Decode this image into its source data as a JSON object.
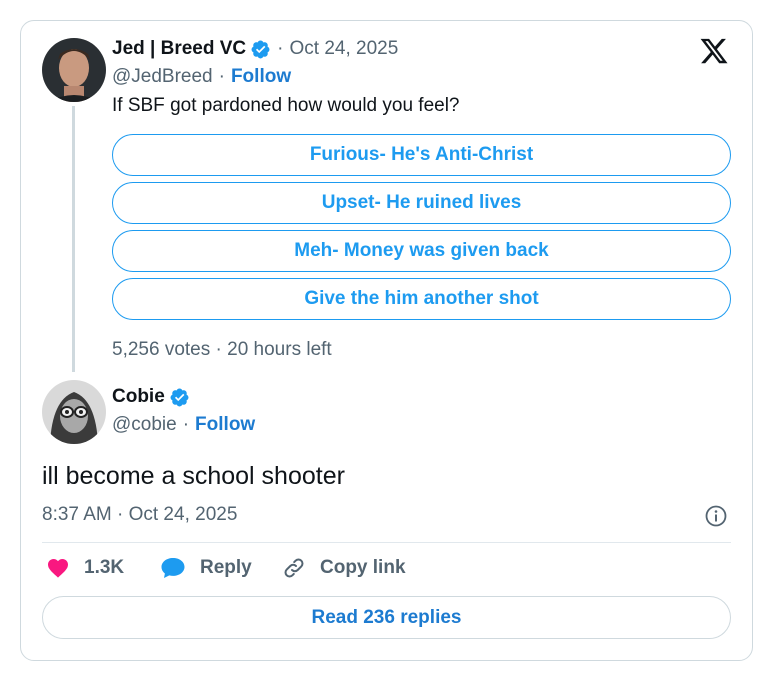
{
  "parent": {
    "author_name": "Jed | Breed VC",
    "handle": "@JedBreed",
    "date": "Oct 24, 2025",
    "follow_label": "Follow",
    "question": "If SBF got pardoned how would you feel?",
    "poll_options": [
      "Furious- He's Anti-Christ",
      "Upset- He ruined lives",
      "Meh- Money was given back",
      "Give the him another shot"
    ],
    "poll_meta": "5,256 votes · 20 hours left"
  },
  "reply": {
    "author_name": "Cobie",
    "handle": "@cobie",
    "follow_label": "Follow",
    "text": "ill become a school shooter",
    "timestamp": "8:37 AM · Oct 24, 2025"
  },
  "actions": {
    "like_count": "1.3K",
    "reply_label": "Reply",
    "copy_label": "Copy link"
  },
  "read_replies_label": "Read 236 replies",
  "icons": {
    "verified": "verified-badge-icon",
    "x_logo": "x-logo-icon",
    "like": "heart-icon",
    "reply": "speech-bubble-icon",
    "copy": "link-icon",
    "info": "info-icon"
  },
  "colors": {
    "accent": "#1d9bf0",
    "like": "#f91880",
    "muted": "#536471",
    "border": "#cfd9de"
  }
}
